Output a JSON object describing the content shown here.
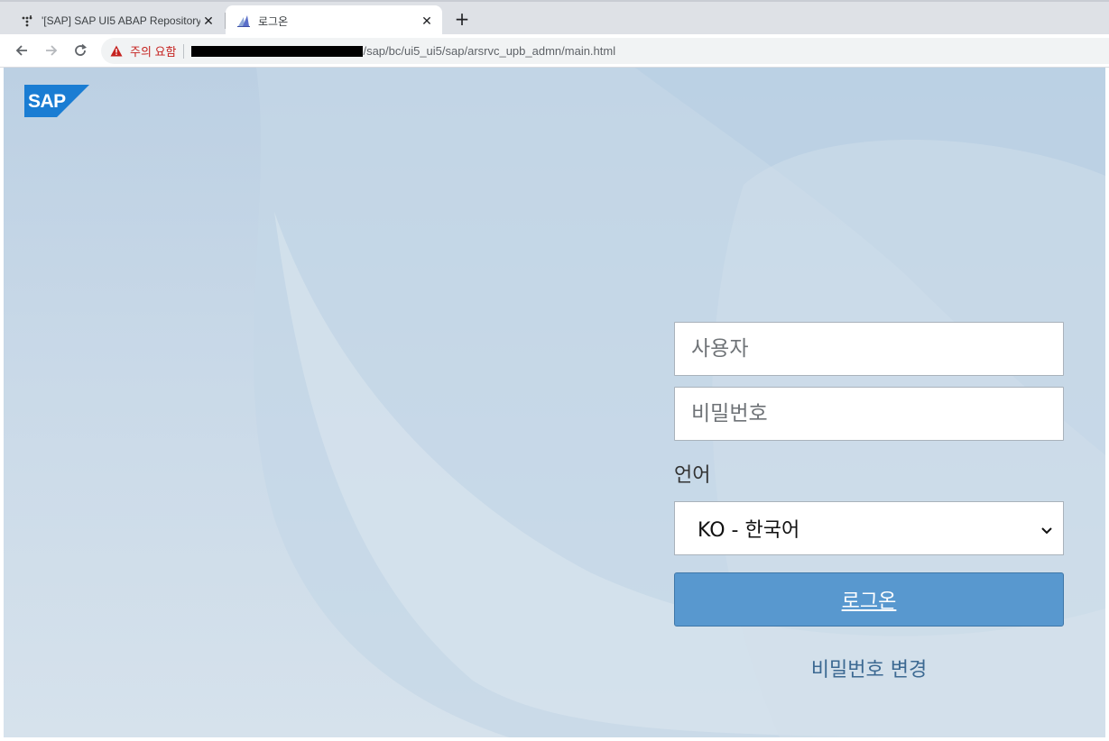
{
  "browser": {
    "tabs": [
      {
        "title": "'[SAP] SAP UI5 ABAP Repository",
        "active": false
      },
      {
        "title": "로그온",
        "active": true
      }
    ],
    "new_tab_label": "+",
    "close_glyph": "✕",
    "security_warning": "주의 요함",
    "url_path": "/sap/bc/ui5_ui5/sap/arsrvc_upb_admn/main.html"
  },
  "login": {
    "user_placeholder": "사용자",
    "password_placeholder": "비밀번호",
    "language_label": "언어",
    "language_selected": "KO - 한국어",
    "login_button": "로그온",
    "change_password": "비밀번호 변경"
  },
  "colors": {
    "accent_button": "#5898cf",
    "link": "#3c6992",
    "warning": "#c5221f",
    "logo_blue": "#1a7dd3"
  }
}
